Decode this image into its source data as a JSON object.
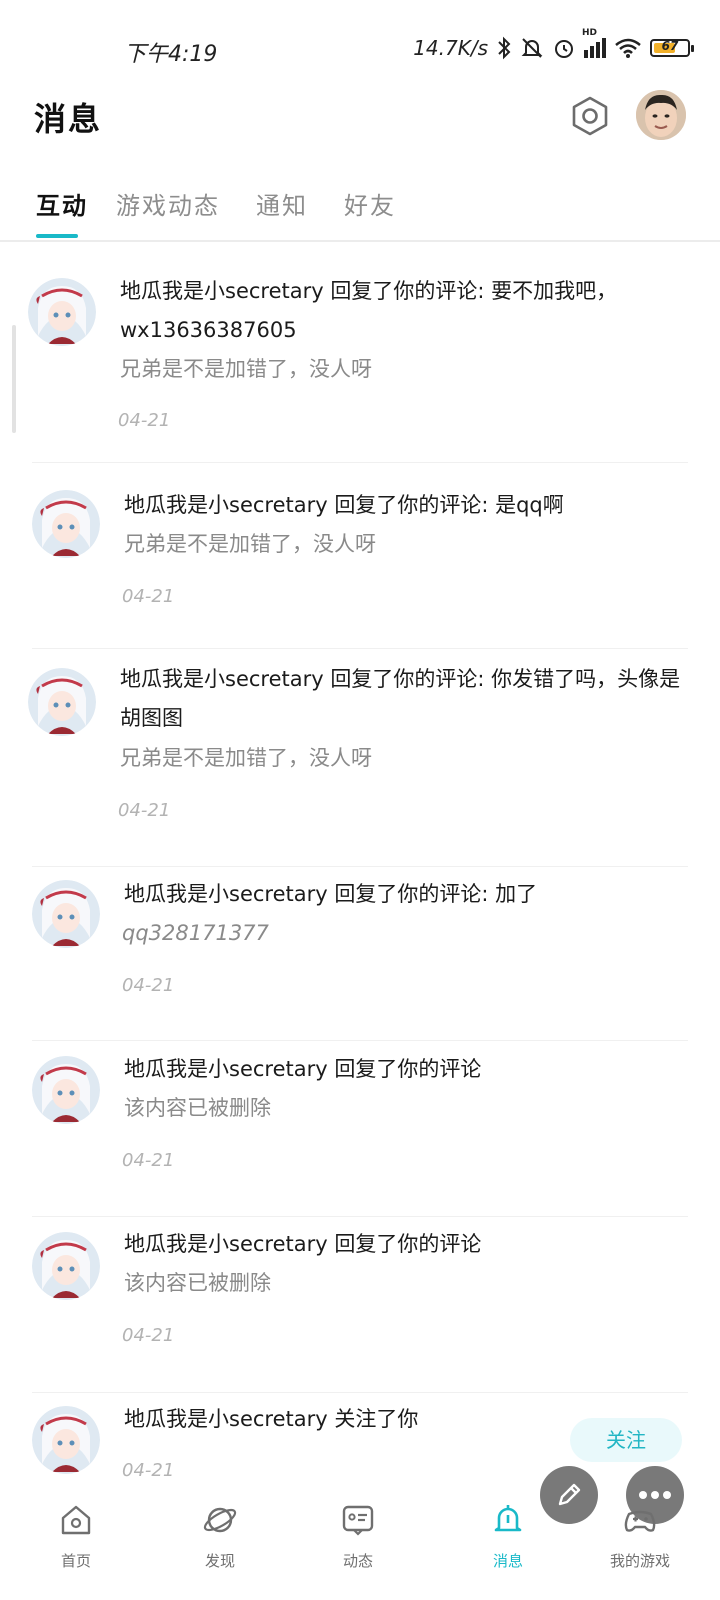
{
  "status_bar": {
    "time": "下午4:19",
    "net_speed": "14.7K/s",
    "network_type": "HD",
    "battery": "67",
    "battery_color": "#f2b12a"
  },
  "header": {
    "title": "消息",
    "settings_icon": "gear-hexagon-icon",
    "avatar_icon": "user-avatar"
  },
  "tabs": [
    {
      "label": "互动",
      "active": true
    },
    {
      "label": "游戏动态",
      "active": false
    },
    {
      "label": "通知",
      "active": false
    },
    {
      "label": "好友",
      "active": false
    }
  ],
  "accent_color": "#19b9c8",
  "messages": [
    {
      "text": "地瓜我是小secretary 回复了你的评论: 要不加我吧，wx13636387605",
      "sub": "兄弟是不是加错了，没人呀",
      "date": "04-21"
    },
    {
      "text": "地瓜我是小secretary 回复了你的评论: 是qq啊",
      "sub": "兄弟是不是加错了，没人呀",
      "date": "04-21"
    },
    {
      "text": "地瓜我是小secretary 回复了你的评论: 你发错了吗，头像是胡图图",
      "sub": "兄弟是不是加错了，没人呀",
      "date": "04-21"
    },
    {
      "text": "地瓜我是小secretary 回复了你的评论: 加了",
      "sub": "qq328171377",
      "date": "04-21"
    },
    {
      "text": "地瓜我是小secretary 回复了你的评论",
      "sub": "该内容已被删除",
      "date": "04-21"
    },
    {
      "text": "地瓜我是小secretary 回复了你的评论",
      "sub": "该内容已被删除",
      "date": "04-21"
    },
    {
      "text": "地瓜我是小secretary 关注了你",
      "sub": "",
      "date": "04-21",
      "action": "关注"
    }
  ],
  "bottom_nav": [
    {
      "label": "首页",
      "icon": "home-icon"
    },
    {
      "label": "发现",
      "icon": "planet-icon"
    },
    {
      "label": "动态",
      "icon": "chat-card-icon"
    },
    {
      "label": "消息",
      "icon": "bell-icon",
      "active": true
    },
    {
      "label": "我的游戏",
      "icon": "gamepad-icon"
    }
  ]
}
